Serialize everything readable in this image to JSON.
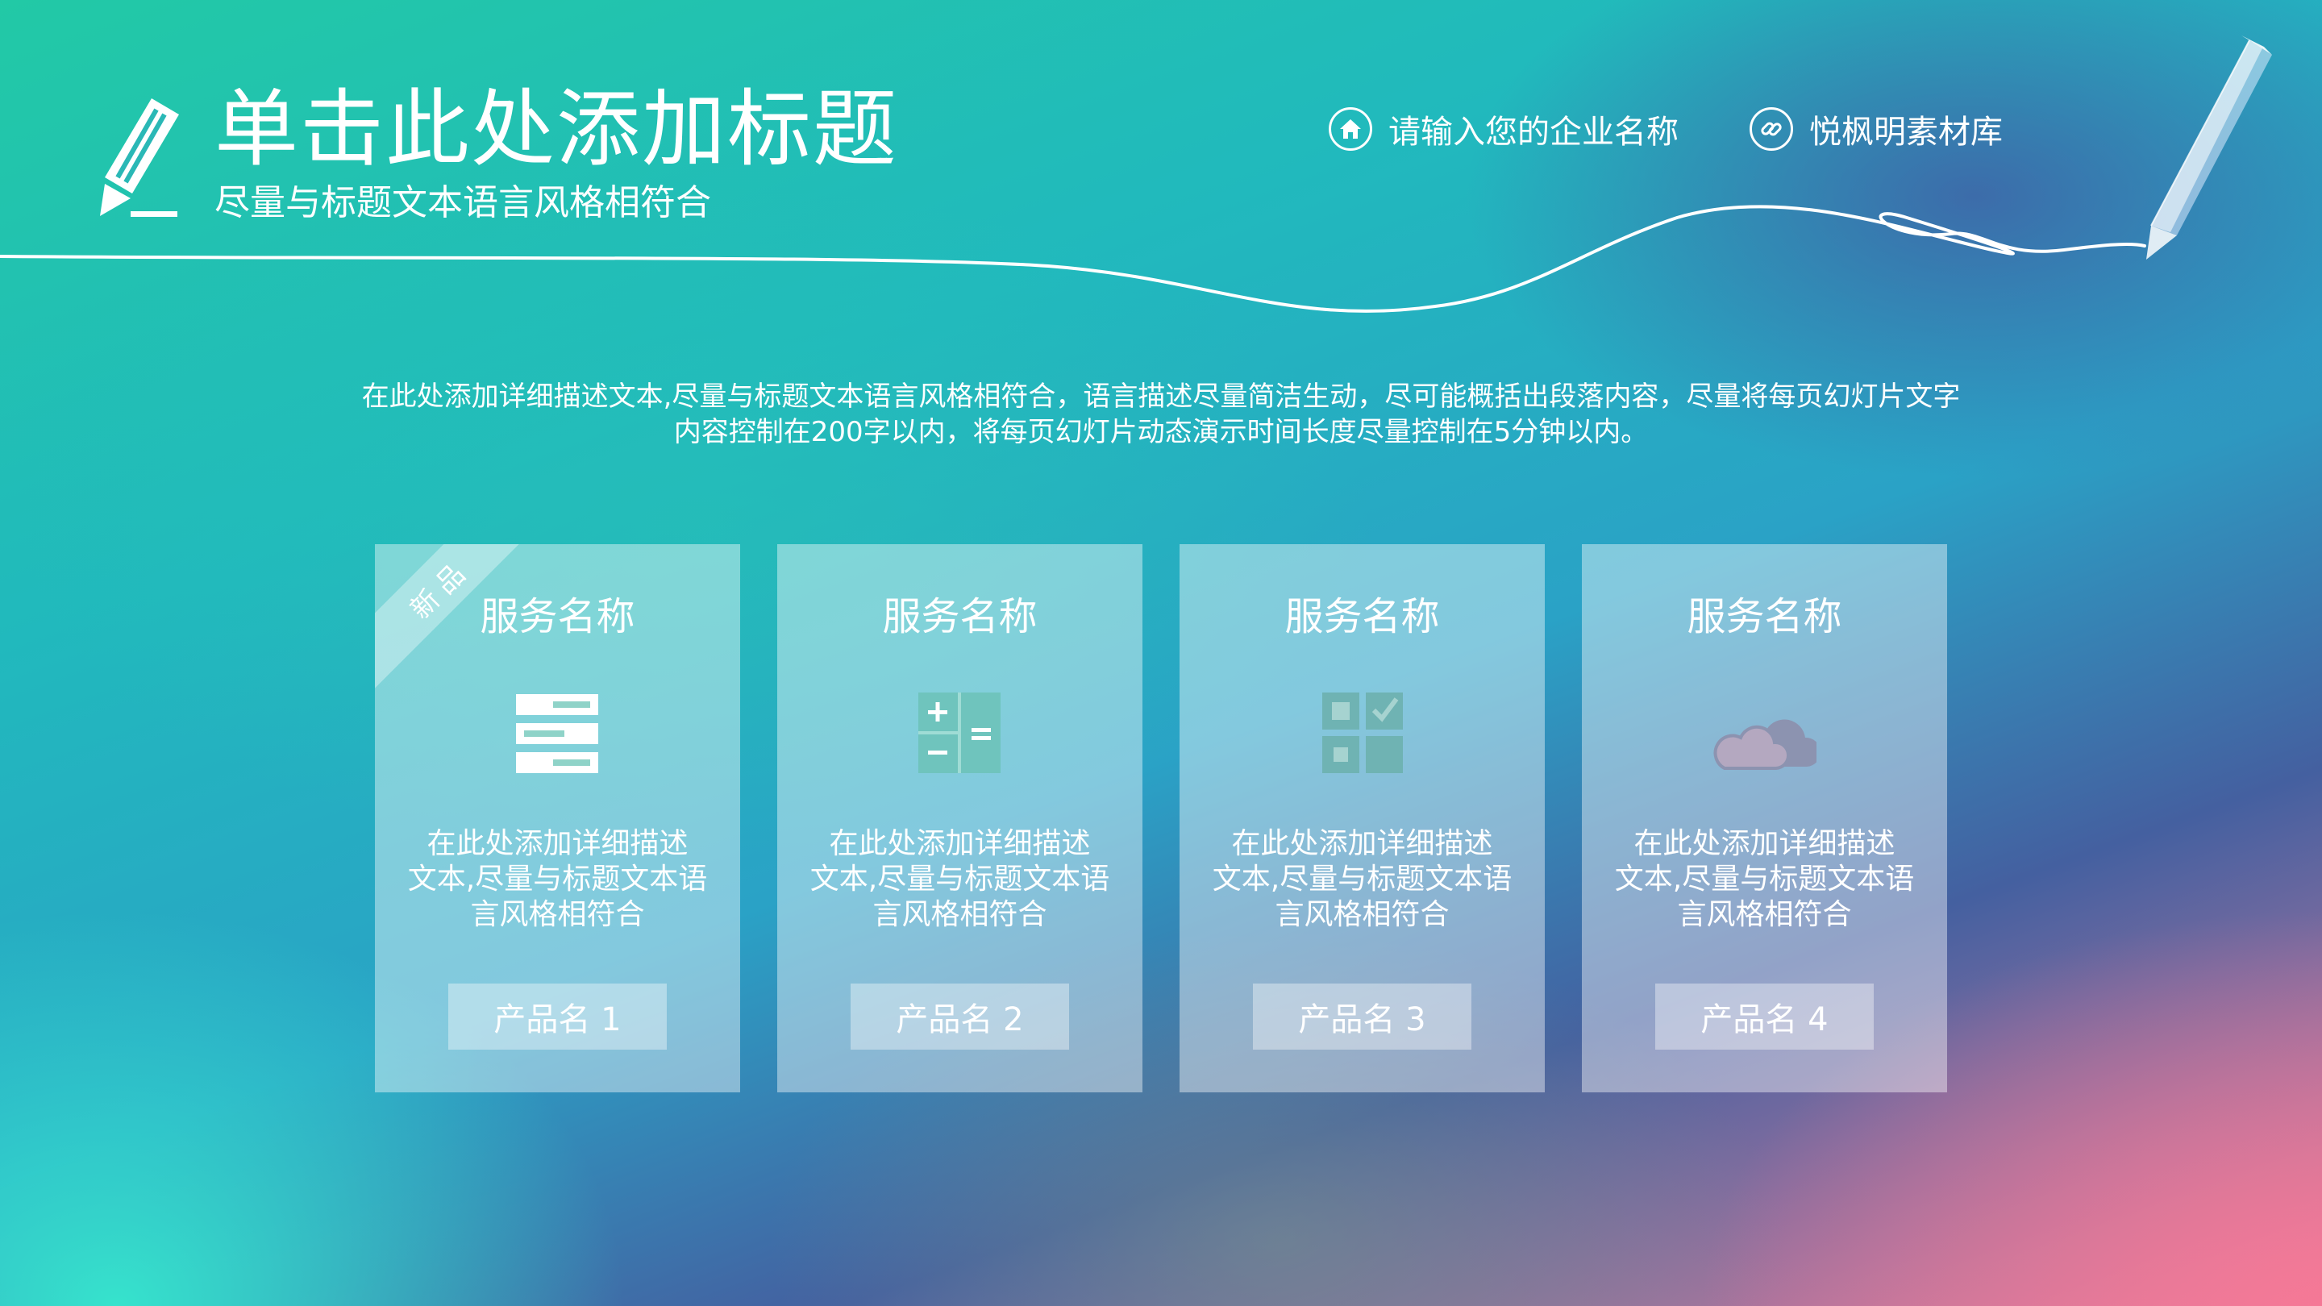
{
  "header": {
    "title": "单击此处添加标题",
    "subtitle": "尽量与标题文本语言风格相符合"
  },
  "links": {
    "company": "请输入您的企业名称",
    "library": "悦枫明素材库"
  },
  "description": {
    "line1": "在此处添加详细描述文本,尽量与标题文本语言风格相符合，语言描述尽量简洁生动，尽可能概括出段落内容，尽量将每页幻灯片文字",
    "line2": "内容控制在200字以内，将每页幻灯片动态演示时间长度尽量控制在5分钟以内。"
  },
  "ribbon": "新品",
  "cards": [
    {
      "name": "服务名称",
      "icon": "server-icon",
      "desc": [
        "在此处添加详细描述",
        "文本,尽量与标题文本语",
        "言风格相符合"
      ],
      "button": "产品名 1"
    },
    {
      "name": "服务名称",
      "icon": "calculator-icon",
      "desc": [
        "在此处添加详细描述",
        "文本,尽量与标题文本语",
        "言风格相符合"
      ],
      "button": "产品名 2"
    },
    {
      "name": "服务名称",
      "icon": "checklist-grid-icon",
      "desc": [
        "在此处添加详细描述",
        "文本,尽量与标题文本语",
        "言风格相符合"
      ],
      "button": "产品名 3"
    },
    {
      "name": "服务名称",
      "icon": "cloud-icon",
      "desc": [
        "在此处添加详细描述",
        "文本,尽量与标题文本语",
        "言风格相符合"
      ],
      "button": "产品名 4"
    }
  ],
  "colors": {
    "iconOnCard": "#ffffff",
    "iconMuted": "#6fb7b5",
    "bgTeal": "#22c9a6",
    "bgPink": "#f07a98",
    "bgNavy": "#44569a"
  }
}
